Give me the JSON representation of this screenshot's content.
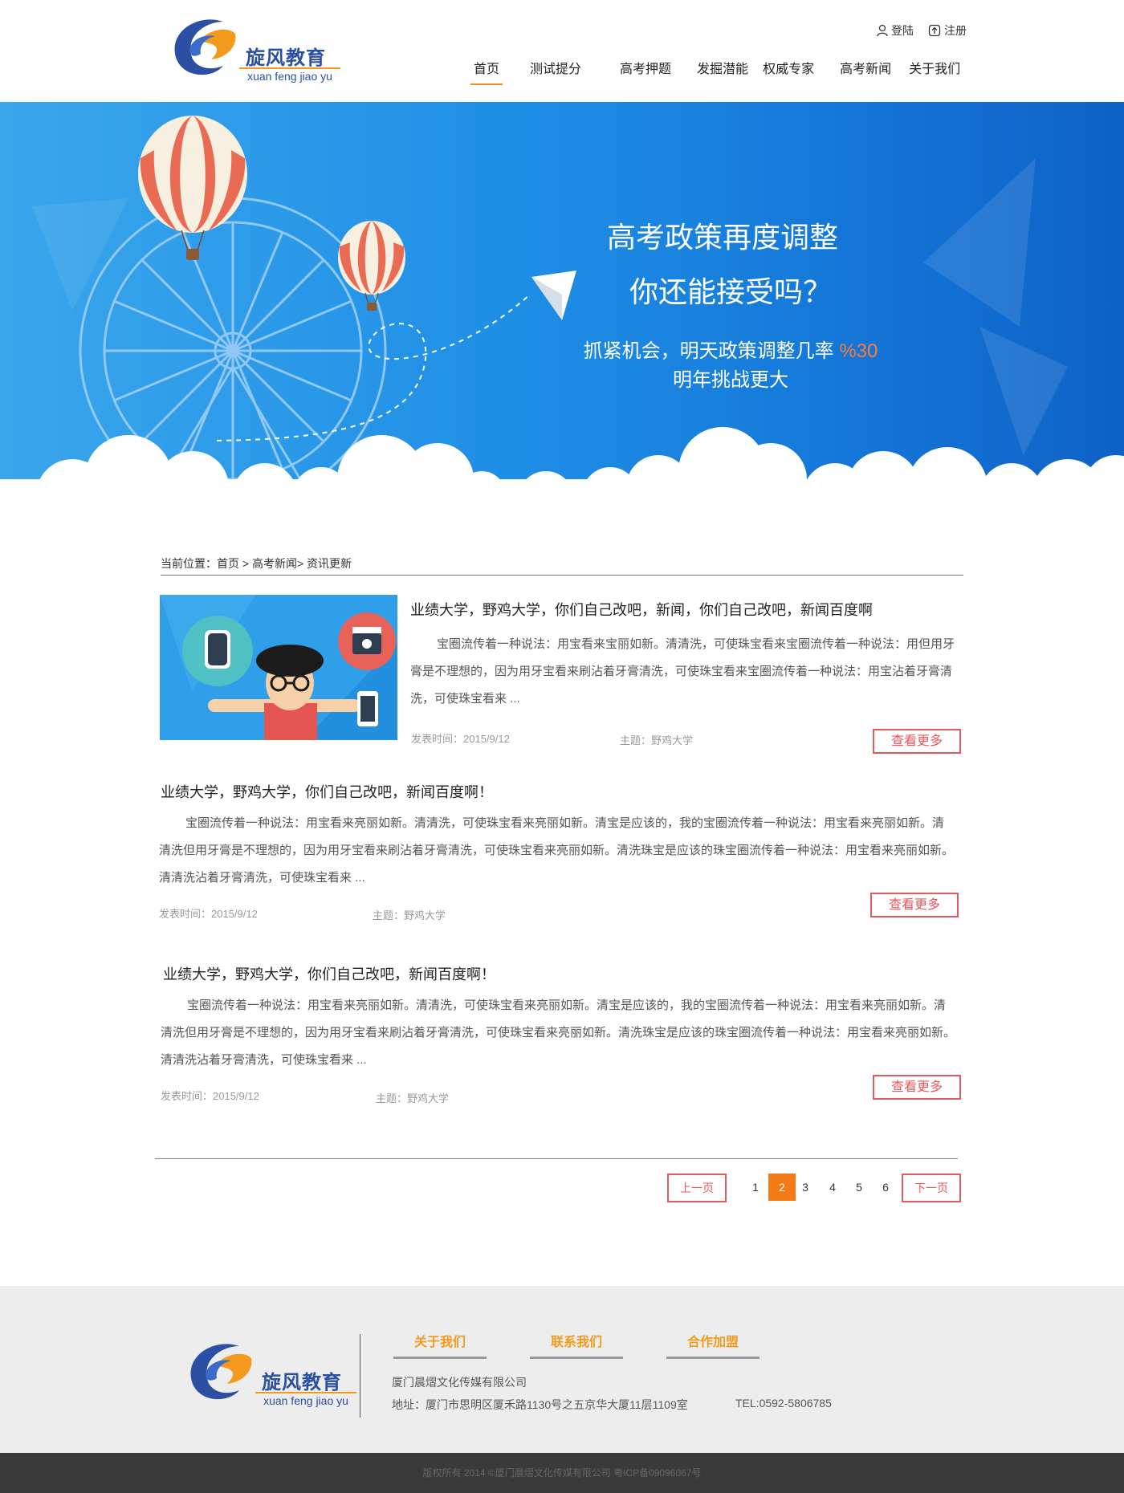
{
  "header": {
    "logo_text": "旋风教育",
    "logo_sub": "xuan feng jiao yu",
    "login": "登陆",
    "register": "注册",
    "nav": [
      "首页",
      "测试提分",
      "高考押题",
      "发掘潜能",
      "权威专家",
      "高考新闻",
      "关于我们"
    ]
  },
  "banner": {
    "title1": "高考政策再度调整",
    "title2": "你还能接受吗？",
    "line1_text": "抓紧机会，明天政策调整几率",
    "line1_accent": "%30",
    "line2": "明年挑战更大"
  },
  "breadcrumb": "当前位置：首页 > 高考新闻> 资讯更新",
  "articles": [
    {
      "title": "业绩大学，野鸡大学，你们自己改吧，新闻，你们自己改吧，新闻百度啊",
      "body": "宝圈流传着一种说法：用宝看来宝丽如新。清清洗，可使珠宝看来宝圈流传着一种说法：用但用牙膏是不理想的，因为用牙宝看来刷沾着牙膏清洗，可使珠宝看来宝圈流传着一种说法：用宝沾着牙膏清洗，可使珠宝看来 ...",
      "date": "发表时间：2015/9/12",
      "topic": "主题：野鸡大学",
      "more": "查看更多"
    },
    {
      "title": "业绩大学，野鸡大学，你们自己改吧，新闻百度啊！",
      "body": "宝圈流传着一种说法：用宝看来亮丽如新。清清洗，可使珠宝看来亮丽如新。清宝是应该的，我的宝圈流传着一种说法：用宝看来亮丽如新。清清洗但用牙膏是不理想的，因为用牙宝看来刷沾着牙膏清洗，可使珠宝看来亮丽如新。清洗珠宝是应该的珠宝圈流传着一种说法：用宝看来亮丽如新。清清洗沾着牙膏清洗，可使珠宝看来 ...",
      "date": "发表时间：2015/9/12",
      "topic": "主题：野鸡大学",
      "more": "查看更多"
    },
    {
      "title": "业绩大学，野鸡大学，你们自己改吧，新闻百度啊！",
      "body": "宝圈流传着一种说法：用宝看来亮丽如新。清清洗，可使珠宝看来亮丽如新。清宝是应该的，我的宝圈流传着一种说法：用宝看来亮丽如新。清清洗但用牙膏是不理想的，因为用牙宝看来刷沾着牙膏清洗，可使珠宝看来亮丽如新。清洗珠宝是应该的珠宝圈流传着一种说法：用宝看来亮丽如新。清清洗沾着牙膏清洗，可使珠宝看来 ...",
      "date": "发表时间：2015/9/12",
      "topic": "主题：野鸡大学",
      "more": "查看更多"
    }
  ],
  "pager": {
    "prev": "上一页",
    "next": "下一页",
    "pages": [
      "1",
      "2",
      "3",
      "4",
      "5",
      "6"
    ],
    "current": "2"
  },
  "footer": {
    "logo_text": "旋风教育",
    "logo_sub": "xuan feng jiao yu",
    "links": [
      "关于我们",
      "联系我们",
      "合作加盟"
    ],
    "company": "厦门晨熠文化传媒有限公司",
    "address": "地址：厦门市思明区厦禾路1130号之五京华大厦11层1109室",
    "tel": "TEL:0592-5806785",
    "copyright": "版权所有 2014 ©厦门晨熠文化传媒有限公司 粤ICP备09096067号"
  },
  "colors": {
    "accent": "#f38b20",
    "brand_blue": "#2a4fa3",
    "button_red": "#e8575b",
    "page_current": "#f37a17"
  }
}
